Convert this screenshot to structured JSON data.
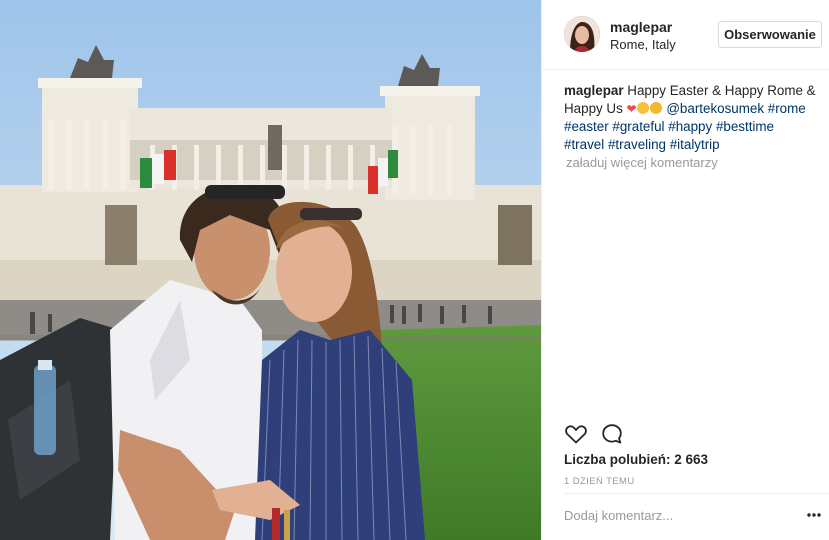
{
  "post": {
    "username": "maglepar",
    "location": "Rome, Italy",
    "follow_label": "Obserwowanie",
    "caption": {
      "username": "maglepar",
      "text": "Happy Easter & Happy Rome & Happy Us",
      "emoji": [
        "red-heart",
        "heart-eyes",
        "kissing-face"
      ],
      "mention": "@bartekosumek",
      "tags": [
        "#rome",
        "#easter",
        "#grateful",
        "#happy",
        "#besttime",
        "#travel",
        "#traveling",
        "#italytrip"
      ]
    },
    "load_more_label": "załaduj więcej komentarzy",
    "likes_label": "Liczba polubień: 2 663",
    "time_label": "1 DZIEŃ TEMU",
    "comment_placeholder": "Dodaj komentarz...",
    "icons": {
      "like": "heart-outline-icon",
      "comment": "speech-bubble-icon",
      "more": "ellipsis-icon"
    },
    "colors": {
      "link": "#003569",
      "muted": "#999999",
      "text": "#262626",
      "border": "#efefef"
    }
  }
}
